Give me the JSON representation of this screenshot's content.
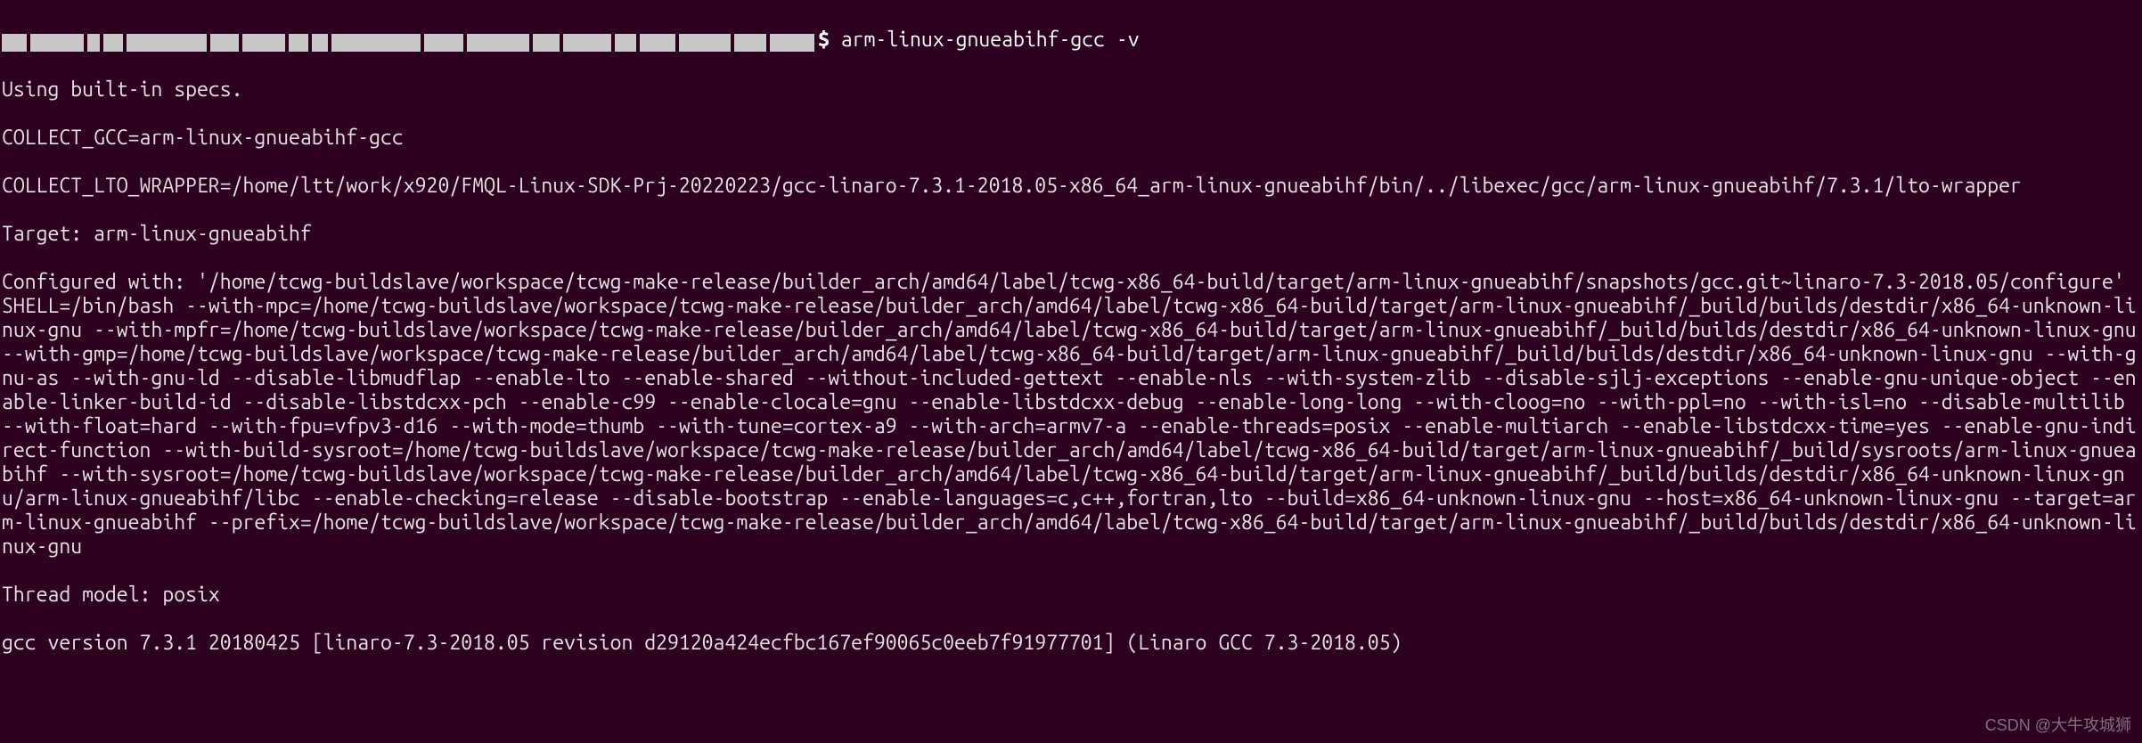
{
  "prompt": {
    "dollar": "$",
    "command": " arm-linux-gnueabihf-gcc -v"
  },
  "lines": {
    "l0": "Using built-in specs.",
    "l1": "COLLECT_GCC=arm-linux-gnueabihf-gcc",
    "l2": "COLLECT_LTO_WRAPPER=/home/ltt/work/x920/FMQL-Linux-SDK-Prj-20220223/gcc-linaro-7.3.1-2018.05-x86_64_arm-linux-gnueabihf/bin/../libexec/gcc/arm-linux-gnueabihf/7.3.1/lto-wrapper",
    "l3": "Target: arm-linux-gnueabihf",
    "l4": "Configured with: '/home/tcwg-buildslave/workspace/tcwg-make-release/builder_arch/amd64/label/tcwg-x86_64-build/target/arm-linux-gnueabihf/snapshots/gcc.git~linaro-7.3-2018.05/configure' SHELL=/bin/bash --with-mpc=/home/tcwg-buildslave/workspace/tcwg-make-release/builder_arch/amd64/label/tcwg-x86_64-build/target/arm-linux-gnueabihf/_build/builds/destdir/x86_64-unknown-linux-gnu --with-mpfr=/home/tcwg-buildslave/workspace/tcwg-make-release/builder_arch/amd64/label/tcwg-x86_64-build/target/arm-linux-gnueabihf/_build/builds/destdir/x86_64-unknown-linux-gnu --with-gmp=/home/tcwg-buildslave/workspace/tcwg-make-release/builder_arch/amd64/label/tcwg-x86_64-build/target/arm-linux-gnueabihf/_build/builds/destdir/x86_64-unknown-linux-gnu --with-gnu-as --with-gnu-ld --disable-libmudflap --enable-lto --enable-shared --without-included-gettext --enable-nls --with-system-zlib --disable-sjlj-exceptions --enable-gnu-unique-object --enable-linker-build-id --disable-libstdcxx-pch --enable-c99 --enable-clocale=gnu --enable-libstdcxx-debug --enable-long-long --with-cloog=no --with-ppl=no --with-isl=no --disable-multilib --with-float=hard --with-fpu=vfpv3-d16 --with-mode=thumb --with-tune=cortex-a9 --with-arch=armv7-a --enable-threads=posix --enable-multiarch --enable-libstdcxx-time=yes --enable-gnu-indirect-function --with-build-sysroot=/home/tcwg-buildslave/workspace/tcwg-make-release/builder_arch/amd64/label/tcwg-x86_64-build/target/arm-linux-gnueabihf/_build/sysroots/arm-linux-gnueabihf --with-sysroot=/home/tcwg-buildslave/workspace/tcwg-make-release/builder_arch/amd64/label/tcwg-x86_64-build/target/arm-linux-gnueabihf/_build/builds/destdir/x86_64-unknown-linux-gnu/arm-linux-gnueabihf/libc --enable-checking=release --disable-bootstrap --enable-languages=c,c++,fortran,lto --build=x86_64-unknown-linux-gnu --host=x86_64-unknown-linux-gnu --target=arm-linux-gnueabihf --prefix=/home/tcwg-buildslave/workspace/tcwg-make-release/builder_arch/amd64/label/tcwg-x86_64-build/target/arm-linux-gnueabihf/_build/builds/destdir/x86_64-unknown-linux-gnu",
    "l5": "Thread model: posix",
    "l6": "gcc version 7.3.1 20180425 [linaro-7.3-2018.05 revision d29120a424ecfbc167ef90065c0eeb7f91977701] (Linaro GCC 7.3-2018.05) "
  },
  "watermark": "CSDN @大牛攻城狮"
}
